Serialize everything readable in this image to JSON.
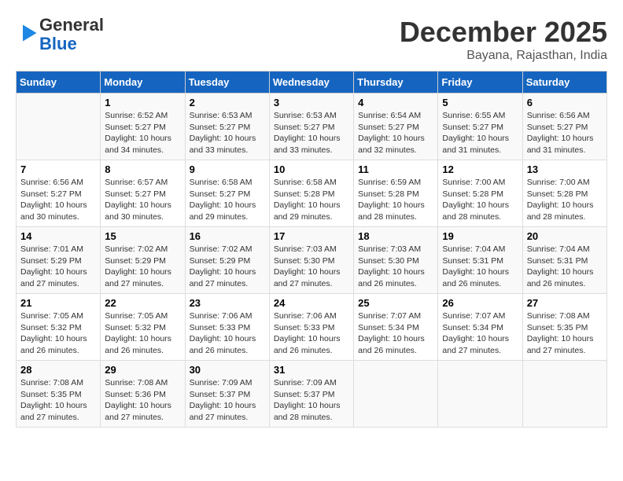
{
  "header": {
    "logo_general": "General",
    "logo_blue": "Blue",
    "month_year": "December 2025",
    "location": "Bayana, Rajasthan, India"
  },
  "weekdays": [
    "Sunday",
    "Monday",
    "Tuesday",
    "Wednesday",
    "Thursday",
    "Friday",
    "Saturday"
  ],
  "weeks": [
    [
      {
        "day": "",
        "text": ""
      },
      {
        "day": "1",
        "text": "Sunrise: 6:52 AM\nSunset: 5:27 PM\nDaylight: 10 hours\nand 34 minutes."
      },
      {
        "day": "2",
        "text": "Sunrise: 6:53 AM\nSunset: 5:27 PM\nDaylight: 10 hours\nand 33 minutes."
      },
      {
        "day": "3",
        "text": "Sunrise: 6:53 AM\nSunset: 5:27 PM\nDaylight: 10 hours\nand 33 minutes."
      },
      {
        "day": "4",
        "text": "Sunrise: 6:54 AM\nSunset: 5:27 PM\nDaylight: 10 hours\nand 32 minutes."
      },
      {
        "day": "5",
        "text": "Sunrise: 6:55 AM\nSunset: 5:27 PM\nDaylight: 10 hours\nand 31 minutes."
      },
      {
        "day": "6",
        "text": "Sunrise: 6:56 AM\nSunset: 5:27 PM\nDaylight: 10 hours\nand 31 minutes."
      }
    ],
    [
      {
        "day": "7",
        "text": "Sunrise: 6:56 AM\nSunset: 5:27 PM\nDaylight: 10 hours\nand 30 minutes."
      },
      {
        "day": "8",
        "text": "Sunrise: 6:57 AM\nSunset: 5:27 PM\nDaylight: 10 hours\nand 30 minutes."
      },
      {
        "day": "9",
        "text": "Sunrise: 6:58 AM\nSunset: 5:27 PM\nDaylight: 10 hours\nand 29 minutes."
      },
      {
        "day": "10",
        "text": "Sunrise: 6:58 AM\nSunset: 5:28 PM\nDaylight: 10 hours\nand 29 minutes."
      },
      {
        "day": "11",
        "text": "Sunrise: 6:59 AM\nSunset: 5:28 PM\nDaylight: 10 hours\nand 28 minutes."
      },
      {
        "day": "12",
        "text": "Sunrise: 7:00 AM\nSunset: 5:28 PM\nDaylight: 10 hours\nand 28 minutes."
      },
      {
        "day": "13",
        "text": "Sunrise: 7:00 AM\nSunset: 5:28 PM\nDaylight: 10 hours\nand 28 minutes."
      }
    ],
    [
      {
        "day": "14",
        "text": "Sunrise: 7:01 AM\nSunset: 5:29 PM\nDaylight: 10 hours\nand 27 minutes."
      },
      {
        "day": "15",
        "text": "Sunrise: 7:02 AM\nSunset: 5:29 PM\nDaylight: 10 hours\nand 27 minutes."
      },
      {
        "day": "16",
        "text": "Sunrise: 7:02 AM\nSunset: 5:29 PM\nDaylight: 10 hours\nand 27 minutes."
      },
      {
        "day": "17",
        "text": "Sunrise: 7:03 AM\nSunset: 5:30 PM\nDaylight: 10 hours\nand 27 minutes."
      },
      {
        "day": "18",
        "text": "Sunrise: 7:03 AM\nSunset: 5:30 PM\nDaylight: 10 hours\nand 26 minutes."
      },
      {
        "day": "19",
        "text": "Sunrise: 7:04 AM\nSunset: 5:31 PM\nDaylight: 10 hours\nand 26 minutes."
      },
      {
        "day": "20",
        "text": "Sunrise: 7:04 AM\nSunset: 5:31 PM\nDaylight: 10 hours\nand 26 minutes."
      }
    ],
    [
      {
        "day": "21",
        "text": "Sunrise: 7:05 AM\nSunset: 5:32 PM\nDaylight: 10 hours\nand 26 minutes."
      },
      {
        "day": "22",
        "text": "Sunrise: 7:05 AM\nSunset: 5:32 PM\nDaylight: 10 hours\nand 26 minutes."
      },
      {
        "day": "23",
        "text": "Sunrise: 7:06 AM\nSunset: 5:33 PM\nDaylight: 10 hours\nand 26 minutes."
      },
      {
        "day": "24",
        "text": "Sunrise: 7:06 AM\nSunset: 5:33 PM\nDaylight: 10 hours\nand 26 minutes."
      },
      {
        "day": "25",
        "text": "Sunrise: 7:07 AM\nSunset: 5:34 PM\nDaylight: 10 hours\nand 26 minutes."
      },
      {
        "day": "26",
        "text": "Sunrise: 7:07 AM\nSunset: 5:34 PM\nDaylight: 10 hours\nand 27 minutes."
      },
      {
        "day": "27",
        "text": "Sunrise: 7:08 AM\nSunset: 5:35 PM\nDaylight: 10 hours\nand 27 minutes."
      }
    ],
    [
      {
        "day": "28",
        "text": "Sunrise: 7:08 AM\nSunset: 5:35 PM\nDaylight: 10 hours\nand 27 minutes."
      },
      {
        "day": "29",
        "text": "Sunrise: 7:08 AM\nSunset: 5:36 PM\nDaylight: 10 hours\nand 27 minutes."
      },
      {
        "day": "30",
        "text": "Sunrise: 7:09 AM\nSunset: 5:37 PM\nDaylight: 10 hours\nand 27 minutes."
      },
      {
        "day": "31",
        "text": "Sunrise: 7:09 AM\nSunset: 5:37 PM\nDaylight: 10 hours\nand 28 minutes."
      },
      {
        "day": "",
        "text": ""
      },
      {
        "day": "",
        "text": ""
      },
      {
        "day": "",
        "text": ""
      }
    ]
  ]
}
